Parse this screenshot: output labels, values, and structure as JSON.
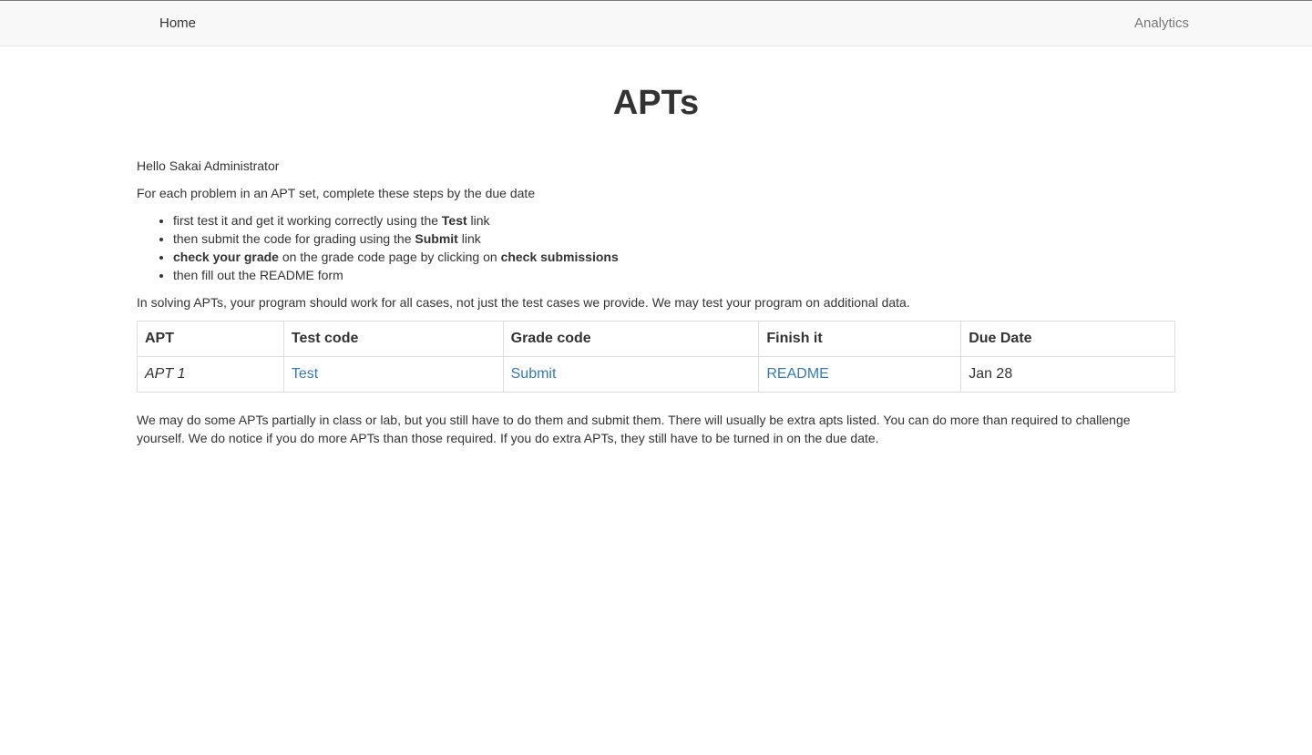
{
  "nav": {
    "home": "Home",
    "analytics": "Analytics"
  },
  "page": {
    "title": "APTs",
    "greeting": "Hello Sakai Administrator",
    "intro": "For each problem in an APT set, complete these steps by the due date",
    "steps": [
      {
        "before": "first test it and get it working correctly using the ",
        "bold": "Test",
        "after": " link"
      },
      {
        "before": "then submit the code for grading using the ",
        "bold": "Submit",
        "after": " link"
      },
      {
        "bold1": "check your grade",
        "middle": " on the grade code page by clicking on ",
        "bold2": "check submissions"
      },
      {
        "text": "then fill out the README form"
      }
    ],
    "solving": "In solving APTs, your program should work for all cases, not just the test cases we provide. We may test your program on additional data.",
    "closing": "We may do some APTs partially in class or lab, but you still have to do them and submit them. There will usually be extra apts listed. You can do more than required to challenge yourself. We do notice if you do more APTs than those required. If you do extra APTs, they still have to be turned in on the due date."
  },
  "table": {
    "headers": [
      "APT",
      "Test code",
      "Grade code",
      "Finish it",
      "Due Date"
    ],
    "rows": [
      {
        "apt": "APT 1",
        "test": "Test",
        "grade": "Submit",
        "finish": "README",
        "due": "Jan 28"
      }
    ]
  },
  "colors": {
    "link": "#337ab7",
    "navbar_bg": "#f8f8f8",
    "text": "#333333"
  }
}
